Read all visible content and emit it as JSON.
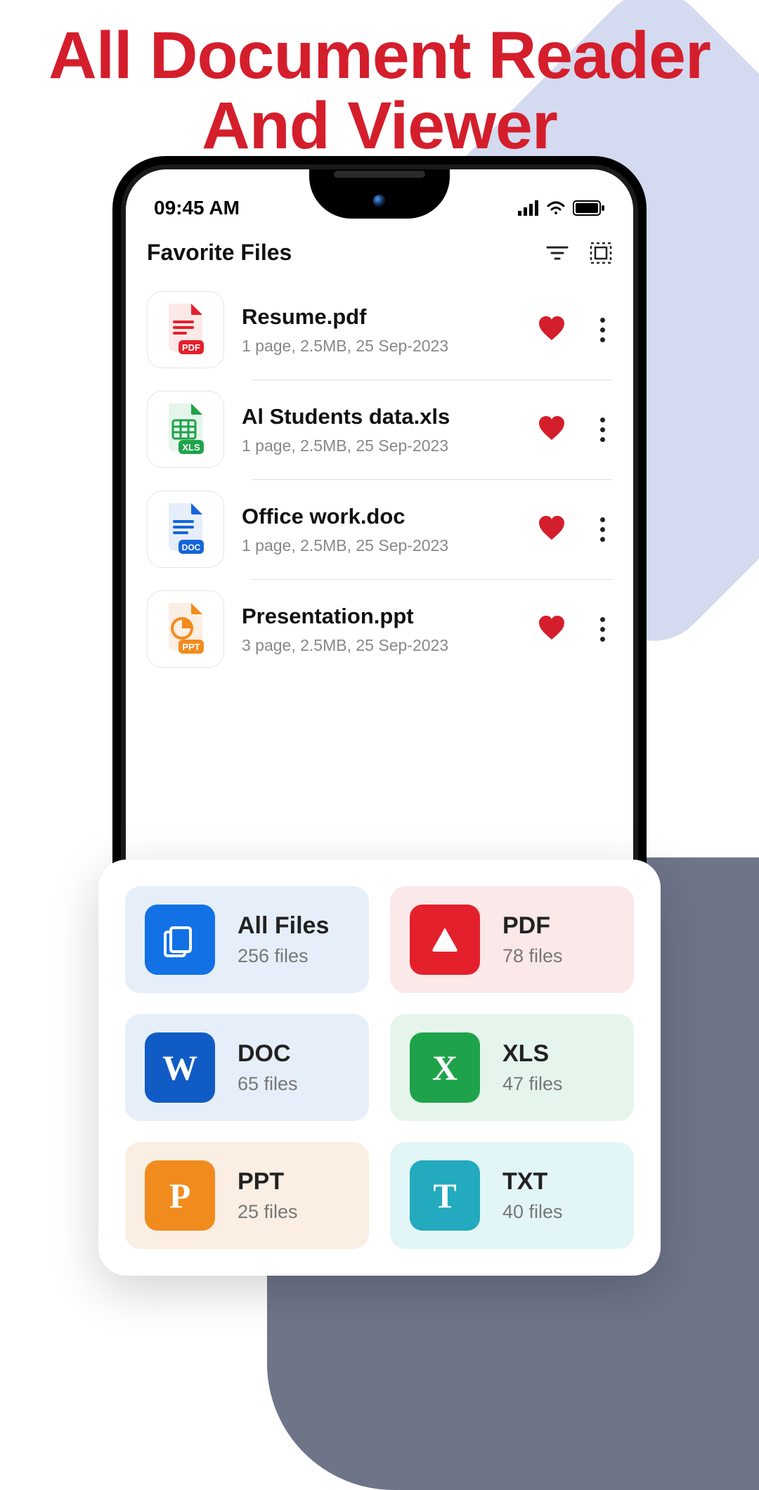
{
  "title": "All Document Reader And Viewer",
  "status": {
    "time": "09:45 AM"
  },
  "header": {
    "title": "Favorite Files"
  },
  "files": [
    {
      "name": "Resume.pdf",
      "meta": "1 page,  2.5MB, 25 Sep-2023",
      "type": "pdf"
    },
    {
      "name": "Al Students data.xls",
      "meta": "1 page,  2.5MB, 25 Sep-2023",
      "type": "xls"
    },
    {
      "name": "Office work.doc",
      "meta": "1 page,  2.5MB, 25 Sep-2023",
      "type": "doc"
    },
    {
      "name": "Presentation.ppt",
      "meta": "3 page,  2.5MB, 25 Sep-2023",
      "type": "ppt"
    }
  ],
  "categories": [
    {
      "title": "All Files",
      "count": "256 files"
    },
    {
      "title": "PDF",
      "count": "78 files"
    },
    {
      "title": "DOC",
      "count": "65 files"
    },
    {
      "title": "XLS",
      "count": "47 files"
    },
    {
      "title": "PPT",
      "count": "25 files"
    },
    {
      "title": "TXT",
      "count": "40 files"
    }
  ]
}
